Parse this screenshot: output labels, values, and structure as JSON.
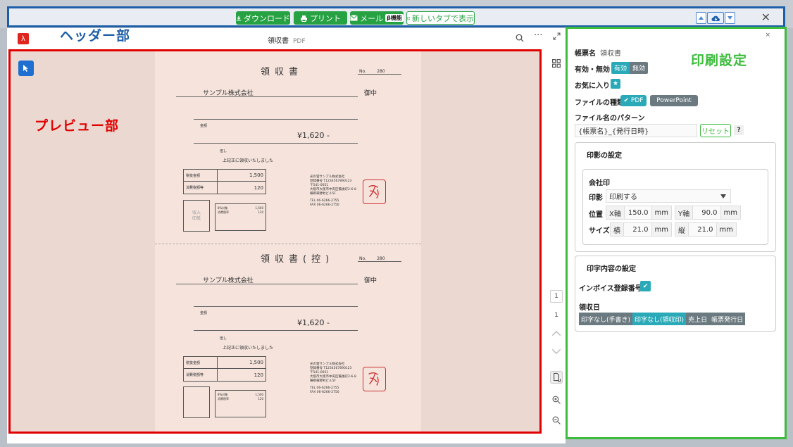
{
  "header": {
    "label": "ヘッダー部",
    "download": "ダウンロード",
    "print": "プリント",
    "mail": "メール",
    "mail_badge": "β機能",
    "new_tab": "新しいタブで表示"
  },
  "viewer": {
    "doc_title": "領収書",
    "doc_format": "PDF",
    "pdf_logo": "λ",
    "more": "···",
    "page_number": "1",
    "page_total": "1"
  },
  "preview": {
    "label": "プレビュー部",
    "receipts": [
      {
        "title": "領収書",
        "no_label": "No.",
        "no_value": "280",
        "company": "サンプル株式会社",
        "honorific": "御中",
        "amount_label": "金額",
        "amount": "¥1,620 -",
        "tadashi": "但し",
        "received": "上記正に領収いたしました",
        "rows": [
          {
            "label": "税抜金額",
            "value": "1,500"
          },
          {
            "label": "消費税額等",
            "value": "120"
          }
        ],
        "stamp_box": "収入\n印紙",
        "tax_rows": [
          {
            "label": "8%対象",
            "value": "1,500"
          },
          {
            "label": "消費税率",
            "value": "120"
          }
        ],
        "issuer": [
          "光の雲サンプル株式会社",
          "登録番号 T1234567890123",
          "〒541-0051",
          "大阪市大阪市中央区備後町2-6-8",
          "横断車野村ビル5F",
          "TEL 06-6266-2755",
          "FAX 06-6266-2750"
        ]
      },
      {
        "title": "領収書(控)",
        "no_label": "No.",
        "no_value": "280",
        "company": "サンプル株式会社",
        "honorific": "御中",
        "amount_label": "金額",
        "amount": "¥1,620 -",
        "tadashi": "但し",
        "received": "上記正に領収いたしました",
        "rows": [
          {
            "label": "税抜金額",
            "value": "1,500"
          },
          {
            "label": "消費税額等",
            "value": "120"
          }
        ],
        "stamp_box": "",
        "tax_rows": [
          {
            "label": "8%対象",
            "value": "1,500"
          },
          {
            "label": "消費税率",
            "value": "120"
          }
        ],
        "issuer": [
          "光の雲サンプル株式会社",
          "登録番号 T1234567890123",
          "〒541-0051",
          "大阪市大阪市中央区備後町2-6-8",
          "横断車野村ビル5F",
          "TEL 06-6266-2755",
          "FAX 06-6266-2750"
        ]
      }
    ]
  },
  "settings": {
    "label": "印刷設定",
    "close": "×",
    "form_name_label": "帳票名",
    "form_name_value": "領収書",
    "enabled_label": "有効・無効",
    "enabled_on": "有効",
    "enabled_off": "無効",
    "favorite_label": "お気に入り",
    "favorite_icon": "★",
    "file_type_label": "ファイルの種類",
    "file_type_pdf": "PDF",
    "file_type_ppt": "PowerPoint",
    "filename_pattern_label": "ファイル名のパターン",
    "filename_pattern_value": "{帳票名}_{発行日時}",
    "reset": "リセット",
    "help": "?",
    "seal_section": "印影の設定",
    "company_seal": "会社印",
    "seal_label": "印影",
    "seal_value": "印刷する",
    "position_label": "位置",
    "x_label": "X軸",
    "x_value": "150.0",
    "y_label": "Y軸",
    "y_value": "90.0",
    "unit": "mm",
    "size_label": "サイズ",
    "w_label": "横",
    "w_value": "21.0",
    "h_label": "縦",
    "h_value": "21.0",
    "print_content_section": "印字内容の設定",
    "invoice_label": "インボイス登録番号",
    "receipt_date_label": "領収日",
    "receipt_date_options": [
      "印字なし(手書き)",
      "印字なし(領収印)",
      "売上日",
      "帳票発行日"
    ],
    "receipt_date_selected": 1
  },
  "colors": {
    "header_border": "#1d5ea8",
    "preview_border": "#e10000",
    "settings_border": "#3dbc3d",
    "button_green": "#27a243",
    "toggle_teal": "#2aaab8"
  }
}
